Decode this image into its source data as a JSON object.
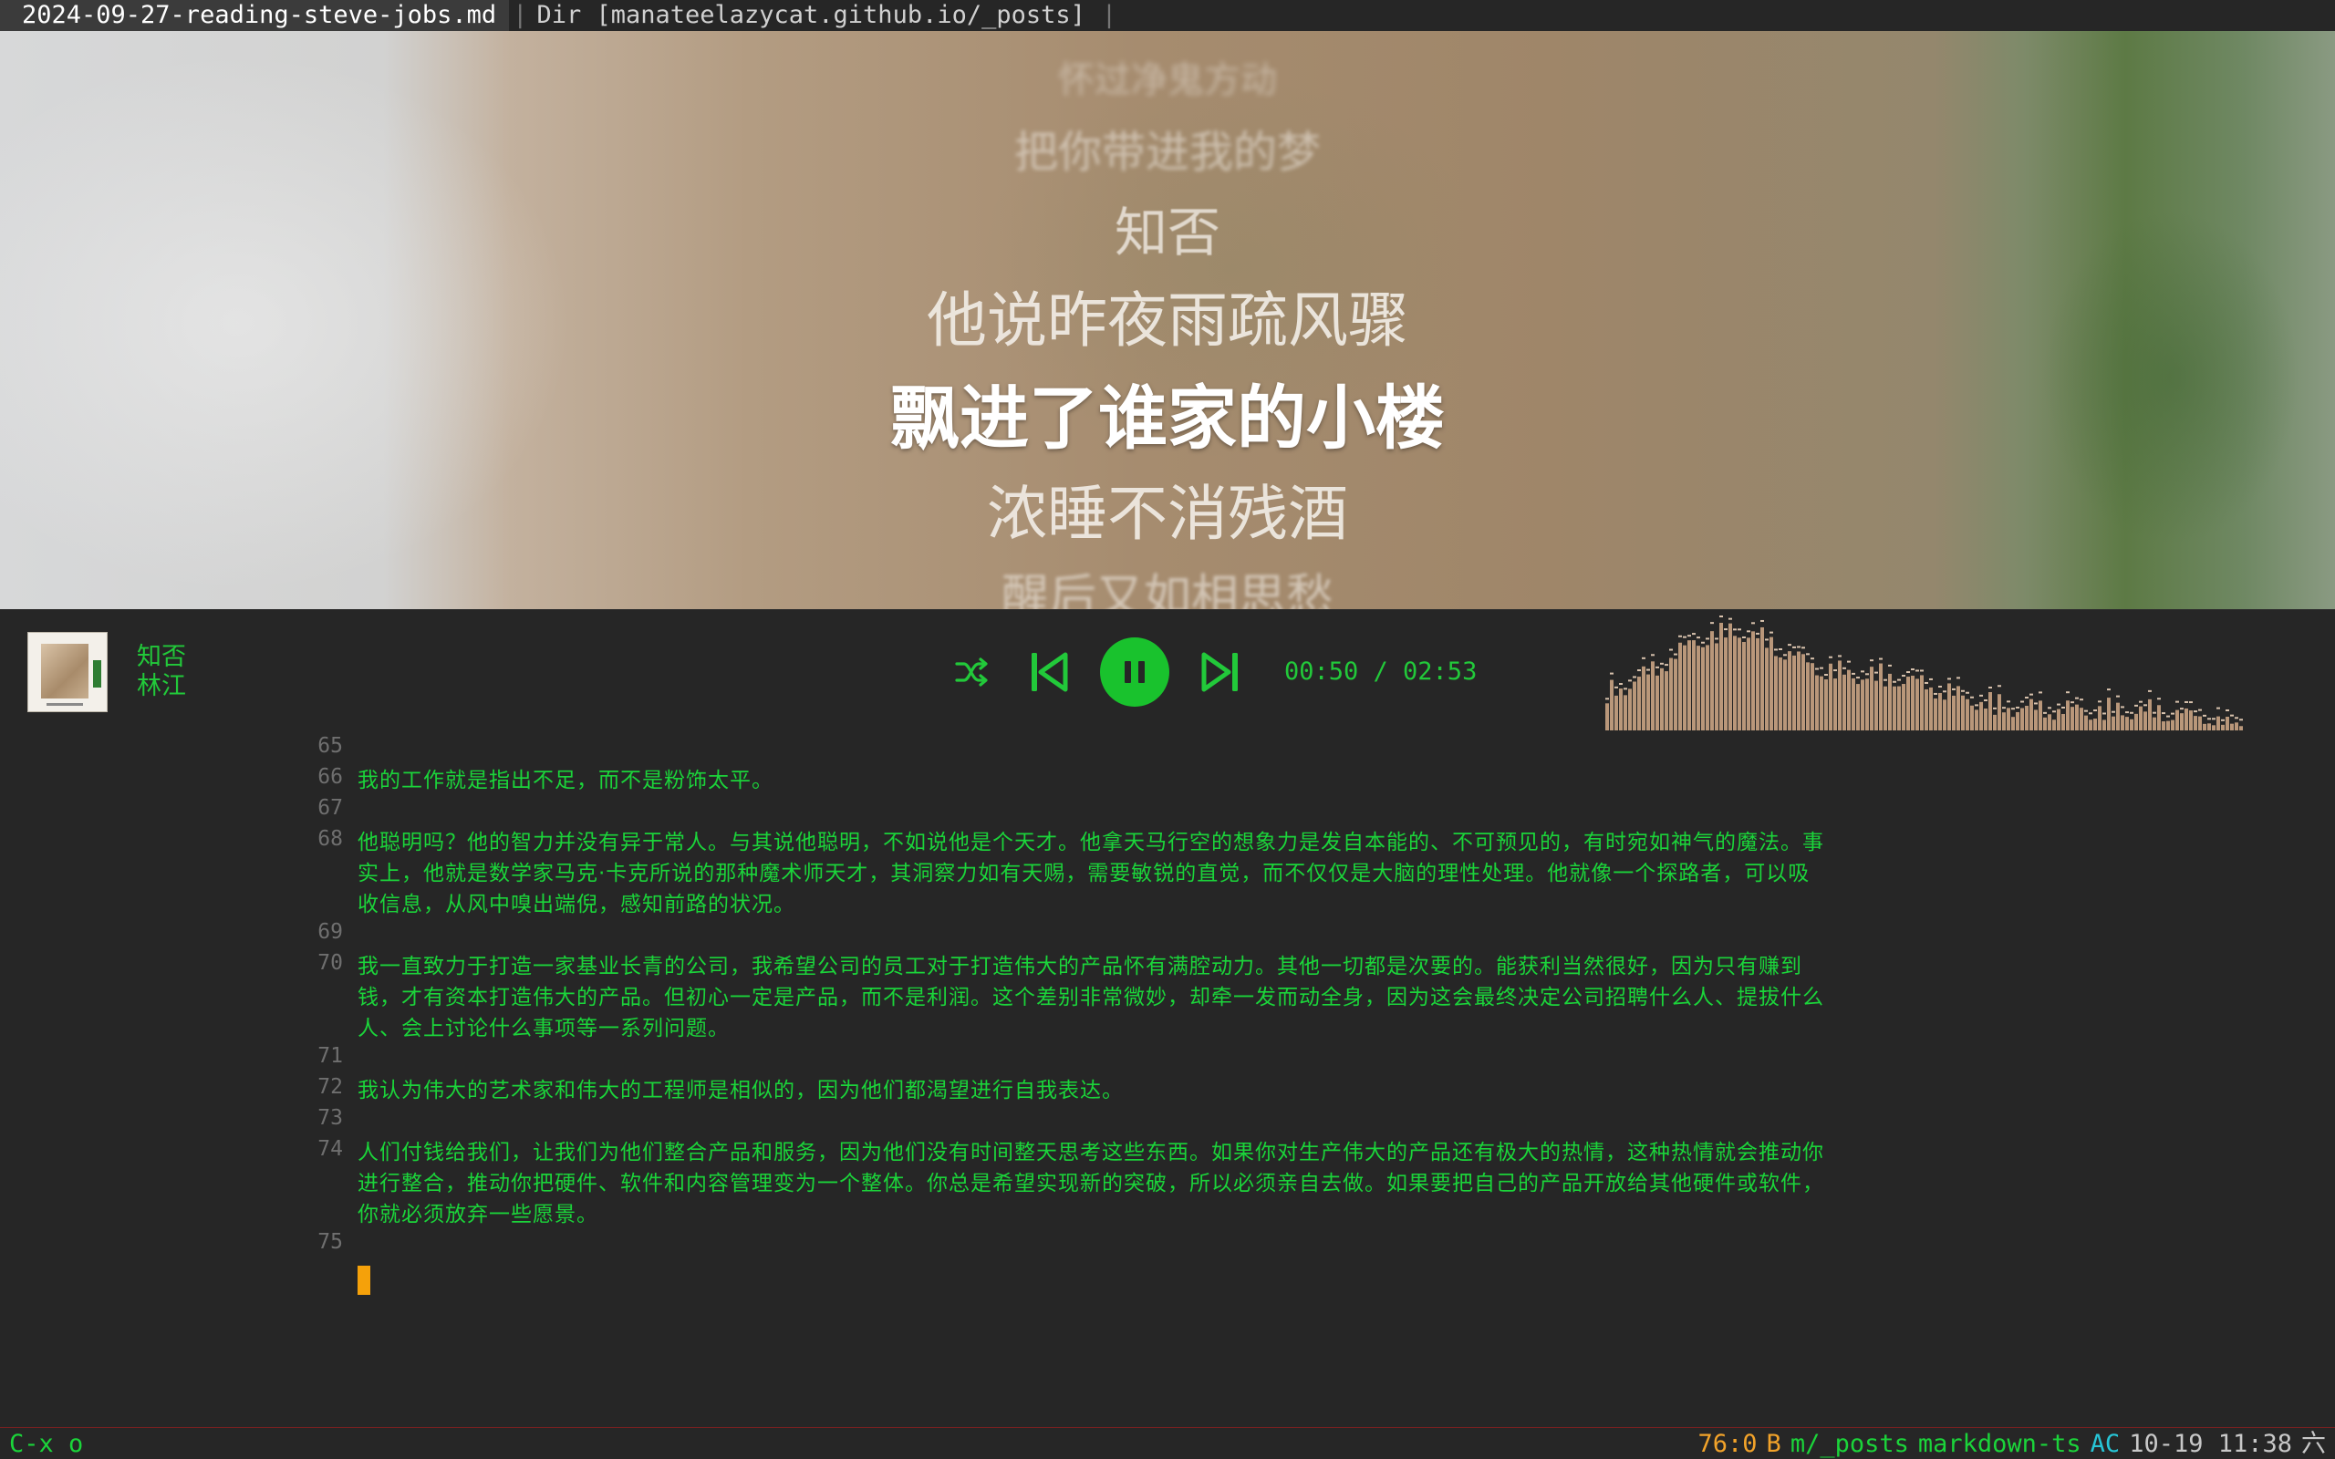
{
  "tabbar": {
    "active_tab": "2024-09-27-reading-steve-jobs.md",
    "separator": "|",
    "dir_tab": "Dir [manateelazycat.github.io/_posts]",
    "trailing_separator": "|"
  },
  "lyrics": [
    "怀过净鬼方动",
    "把你带进我的梦",
    "知否",
    "他说昨夜雨疏风骤",
    "飘进了谁家的小楼",
    "浓睡不消残酒",
    "醒后又如相思愁"
  ],
  "player": {
    "title": "知否",
    "artist": "林江",
    "time": "00:50 / 02:53",
    "progress_fraction": 0.289,
    "state": "playing",
    "accent_color": "#19c22d",
    "icons": [
      "shuffle-icon",
      "previous-icon",
      "pause-icon",
      "next-icon"
    ]
  },
  "editor": {
    "text_color": "#1bd43a",
    "lines": [
      {
        "num": "65",
        "rows": []
      },
      {
        "num": "66",
        "rows": [
          "我的工作就是指出不足，而不是粉饰太平。"
        ]
      },
      {
        "num": "67",
        "rows": []
      },
      {
        "num": "68",
        "rows": [
          "他聪明吗？他的智力并没有异于常人。与其说他聪明，不如说他是个天才。他拿天马行空的想象力是发自本能的、不可预见的，有时宛如神气的魔法。事",
          "实上，他就是数学家马克·卡克所说的那种魔术师天才，其洞察力如有天赐，需要敏锐的直觉，而不仅仅是大脑的理性处理。他就像一个探路者，可以吸",
          "收信息，从风中嗅出端倪，感知前路的状况。"
        ]
      },
      {
        "num": "69",
        "rows": []
      },
      {
        "num": "70",
        "rows": [
          "我一直致力于打造一家基业长青的公司，我希望公司的员工对于打造伟大的产品怀有满腔动力。其他一切都是次要的。能获利当然很好，因为只有赚到",
          "钱，才有资本打造伟大的产品。但初心一定是产品，而不是利润。这个差别非常微妙，却牵一发而动全身，因为这会最终决定公司招聘什么人、提拔什么",
          "人、会上讨论什么事项等一系列问题。"
        ]
      },
      {
        "num": "71",
        "rows": []
      },
      {
        "num": "72",
        "rows": [
          "我认为伟大的艺术家和伟大的工程师是相似的，因为他们都渴望进行自我表达。"
        ]
      },
      {
        "num": "73",
        "rows": []
      },
      {
        "num": "74",
        "rows": [
          "人们付钱给我们，让我们为他们整合产品和服务，因为他们没有时间整天思考这些东西。如果你对生产伟大的产品还有极大的热情，这种热情就会推动你",
          "进行整合，推动你把硬件、软件和内容管理变为一个整体。你总是希望实现新的突破，所以必须亲自去做。如果要把自己的产品开放给其他硬件或软件，",
          "你就必须放弃一些愿景。"
        ]
      },
      {
        "num": "75",
        "rows": []
      }
    ]
  },
  "modeline": {
    "keys": "C-x o",
    "position": "76:0",
    "flag": "B",
    "dir": "m/_posts",
    "mode": "markdown-ts",
    "minor": "AC",
    "datetime": "10-19 11:38",
    "weekday": "六"
  }
}
